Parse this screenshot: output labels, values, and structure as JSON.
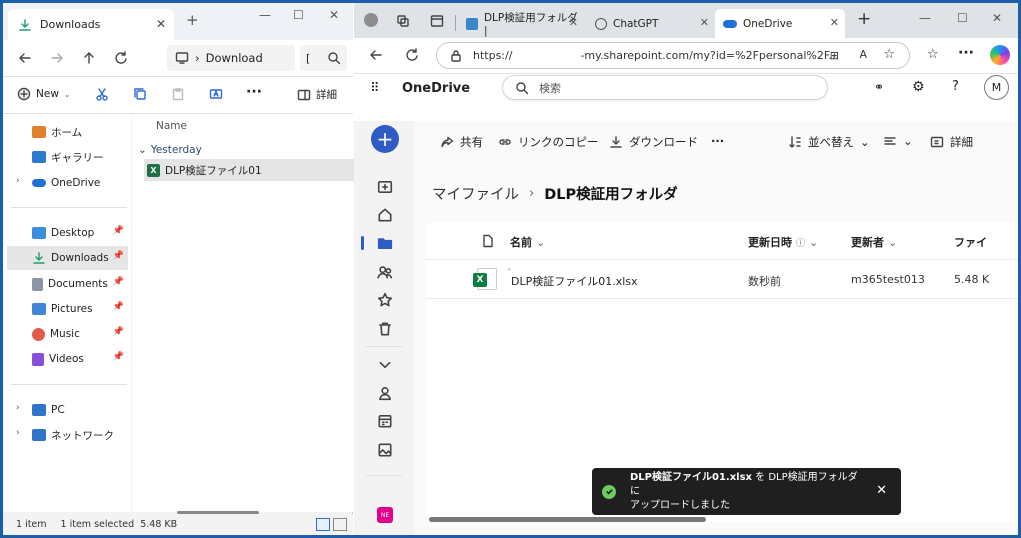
{
  "explorer": {
    "tab_title": "Downloads",
    "breadcrumb": "Download",
    "breadcrumb_more": "[",
    "cmd": {
      "new_label": "New",
      "details_label": "詳細"
    },
    "nav": [
      {
        "label": "ホーム",
        "icon": "home-icon",
        "color": "#e0812b"
      },
      {
        "label": "ギャラリー",
        "icon": "gallery-icon",
        "color": "#2f7ad1"
      },
      {
        "label": "OneDrive",
        "icon": "cloud-icon",
        "color": "#1e6fd9"
      },
      {
        "label": "Desktop",
        "icon": "desktop-icon",
        "color": "#3b8edb"
      },
      {
        "label": "Downloads",
        "icon": "download-icon",
        "color": "#1e9e6a"
      },
      {
        "label": "Documents",
        "icon": "documents-icon",
        "color": "#8b95a5"
      },
      {
        "label": "Pictures",
        "icon": "pictures-icon",
        "color": "#3f86d6"
      },
      {
        "label": "Music",
        "icon": "music-icon",
        "color": "#e25b4a"
      },
      {
        "label": "Videos",
        "icon": "videos-icon",
        "color": "#8a4fd6"
      },
      {
        "label": "PC",
        "icon": "pc-icon",
        "color": "#2f74c9"
      },
      {
        "label": "ネットワーク",
        "icon": "network-icon",
        "color": "#2f74c9"
      }
    ],
    "column_name": "Name",
    "group_label": "Yesterday",
    "file_name": "DLP検証ファイル01",
    "status": {
      "items": "1 item",
      "selected": "1 item selected",
      "size": "5.48 KB"
    }
  },
  "edge": {
    "tabs": [
      {
        "label": "DLP検証用フォルダ |",
        "icon": "sharepoint-icon"
      },
      {
        "label": "ChatGPT",
        "icon": "chatgpt-icon"
      },
      {
        "label": "OneDrive",
        "icon": "onedrive-icon"
      }
    ],
    "url_prefix": "https://",
    "url_rest": "-my.sharepoint.com/my?id=%2Fpersonal%2F..."
  },
  "onedrive": {
    "brand": "OneDrive",
    "search_placeholder": "検索",
    "avatar_letter": "M",
    "cmd": {
      "share": "共有",
      "copy_link": "リンクのコピー",
      "download": "ダウンロード",
      "more": "···",
      "sort": "並べ替え",
      "details": "詳細"
    },
    "breadcrumb": {
      "root": "マイファイル",
      "current": "DLP検証用フォルダ"
    },
    "columns": {
      "name": "名前",
      "modified": "更新日時",
      "modified_by": "更新者",
      "size": "ファイ"
    },
    "file": {
      "name": "DLP検証ファイル01.xlsx",
      "modified": "数秒前",
      "modified_by": "m365test013",
      "size": "5.48 K"
    },
    "toast": {
      "bold": "DLP検証ファイル01.xlsx",
      "text": " を DLP検証用フォルダ に",
      "line2": "アップロードしました"
    },
    "rail_badge": "NE"
  }
}
